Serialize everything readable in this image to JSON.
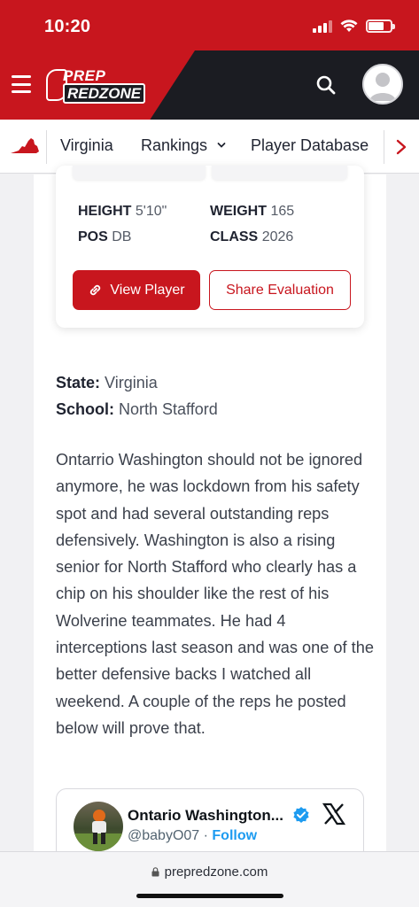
{
  "status_bar": {
    "time": "10:20"
  },
  "header": {
    "logo_top": "PREP",
    "logo_bottom": "REDZONE",
    "brand_color": "#c8161e"
  },
  "nav": {
    "items": [
      {
        "label": "Virginia"
      },
      {
        "label": "Rankings"
      },
      {
        "label": "Player Database"
      }
    ]
  },
  "player_card": {
    "height_label": "HEIGHT",
    "height_value": "5'10\"",
    "weight_label": "WEIGHT",
    "weight_value": "165",
    "pos_label": "POS",
    "pos_value": "DB",
    "class_label": "CLASS",
    "class_value": "2026",
    "view_button": "View Player",
    "share_button": "Share Evaluation"
  },
  "meta": {
    "state_label": "State:",
    "state_value": "Virginia",
    "school_label": "School:",
    "school_value": "North Stafford"
  },
  "article": {
    "body": "Ontarrio Washington should not be ignored anymore, he was lockdown from his safety spot and had several outstanding reps defensively. Washington is also a rising senior for North Stafford who clearly has a chip on his shoulder like the rest of his Wolverine teammates. He had 4 interceptions last season and was one of the better defensive backs I watched all weekend. A couple of the reps he posted below will prove that."
  },
  "tweet": {
    "name": "Ontario Washington...",
    "handle": "@babyO07",
    "separator": " · ",
    "follow": "Follow"
  },
  "browser": {
    "url": "prepredzone.com"
  }
}
